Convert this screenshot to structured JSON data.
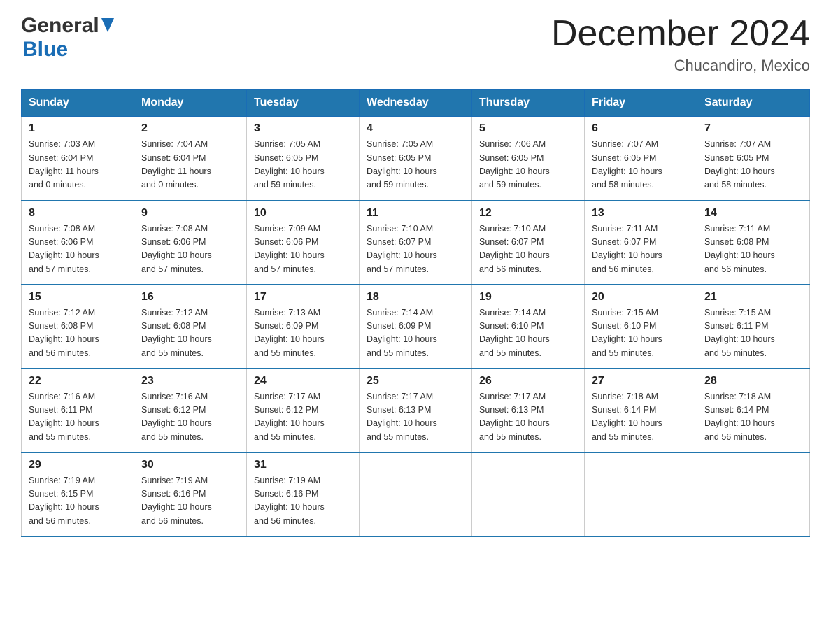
{
  "logo": {
    "general": "General",
    "blue": "Blue"
  },
  "header": {
    "month": "December 2024",
    "location": "Chucandiro, Mexico"
  },
  "weekdays": [
    "Sunday",
    "Monday",
    "Tuesday",
    "Wednesday",
    "Thursday",
    "Friday",
    "Saturday"
  ],
  "weeks": [
    [
      {
        "day": "1",
        "sunrise": "7:03 AM",
        "sunset": "6:04 PM",
        "daylight": "11 hours and 0 minutes."
      },
      {
        "day": "2",
        "sunrise": "7:04 AM",
        "sunset": "6:04 PM",
        "daylight": "11 hours and 0 minutes."
      },
      {
        "day": "3",
        "sunrise": "7:05 AM",
        "sunset": "6:05 PM",
        "daylight": "10 hours and 59 minutes."
      },
      {
        "day": "4",
        "sunrise": "7:05 AM",
        "sunset": "6:05 PM",
        "daylight": "10 hours and 59 minutes."
      },
      {
        "day": "5",
        "sunrise": "7:06 AM",
        "sunset": "6:05 PM",
        "daylight": "10 hours and 59 minutes."
      },
      {
        "day": "6",
        "sunrise": "7:07 AM",
        "sunset": "6:05 PM",
        "daylight": "10 hours and 58 minutes."
      },
      {
        "day": "7",
        "sunrise": "7:07 AM",
        "sunset": "6:05 PM",
        "daylight": "10 hours and 58 minutes."
      }
    ],
    [
      {
        "day": "8",
        "sunrise": "7:08 AM",
        "sunset": "6:06 PM",
        "daylight": "10 hours and 57 minutes."
      },
      {
        "day": "9",
        "sunrise": "7:08 AM",
        "sunset": "6:06 PM",
        "daylight": "10 hours and 57 minutes."
      },
      {
        "day": "10",
        "sunrise": "7:09 AM",
        "sunset": "6:06 PM",
        "daylight": "10 hours and 57 minutes."
      },
      {
        "day": "11",
        "sunrise": "7:10 AM",
        "sunset": "6:07 PM",
        "daylight": "10 hours and 57 minutes."
      },
      {
        "day": "12",
        "sunrise": "7:10 AM",
        "sunset": "6:07 PM",
        "daylight": "10 hours and 56 minutes."
      },
      {
        "day": "13",
        "sunrise": "7:11 AM",
        "sunset": "6:07 PM",
        "daylight": "10 hours and 56 minutes."
      },
      {
        "day": "14",
        "sunrise": "7:11 AM",
        "sunset": "6:08 PM",
        "daylight": "10 hours and 56 minutes."
      }
    ],
    [
      {
        "day": "15",
        "sunrise": "7:12 AM",
        "sunset": "6:08 PM",
        "daylight": "10 hours and 56 minutes."
      },
      {
        "day": "16",
        "sunrise": "7:12 AM",
        "sunset": "6:08 PM",
        "daylight": "10 hours and 55 minutes."
      },
      {
        "day": "17",
        "sunrise": "7:13 AM",
        "sunset": "6:09 PM",
        "daylight": "10 hours and 55 minutes."
      },
      {
        "day": "18",
        "sunrise": "7:14 AM",
        "sunset": "6:09 PM",
        "daylight": "10 hours and 55 minutes."
      },
      {
        "day": "19",
        "sunrise": "7:14 AM",
        "sunset": "6:10 PM",
        "daylight": "10 hours and 55 minutes."
      },
      {
        "day": "20",
        "sunrise": "7:15 AM",
        "sunset": "6:10 PM",
        "daylight": "10 hours and 55 minutes."
      },
      {
        "day": "21",
        "sunrise": "7:15 AM",
        "sunset": "6:11 PM",
        "daylight": "10 hours and 55 minutes."
      }
    ],
    [
      {
        "day": "22",
        "sunrise": "7:16 AM",
        "sunset": "6:11 PM",
        "daylight": "10 hours and 55 minutes."
      },
      {
        "day": "23",
        "sunrise": "7:16 AM",
        "sunset": "6:12 PM",
        "daylight": "10 hours and 55 minutes."
      },
      {
        "day": "24",
        "sunrise": "7:17 AM",
        "sunset": "6:12 PM",
        "daylight": "10 hours and 55 minutes."
      },
      {
        "day": "25",
        "sunrise": "7:17 AM",
        "sunset": "6:13 PM",
        "daylight": "10 hours and 55 minutes."
      },
      {
        "day": "26",
        "sunrise": "7:17 AM",
        "sunset": "6:13 PM",
        "daylight": "10 hours and 55 minutes."
      },
      {
        "day": "27",
        "sunrise": "7:18 AM",
        "sunset": "6:14 PM",
        "daylight": "10 hours and 55 minutes."
      },
      {
        "day": "28",
        "sunrise": "7:18 AM",
        "sunset": "6:14 PM",
        "daylight": "10 hours and 56 minutes."
      }
    ],
    [
      {
        "day": "29",
        "sunrise": "7:19 AM",
        "sunset": "6:15 PM",
        "daylight": "10 hours and 56 minutes."
      },
      {
        "day": "30",
        "sunrise": "7:19 AM",
        "sunset": "6:16 PM",
        "daylight": "10 hours and 56 minutes."
      },
      {
        "day": "31",
        "sunrise": "7:19 AM",
        "sunset": "6:16 PM",
        "daylight": "10 hours and 56 minutes."
      },
      null,
      null,
      null,
      null
    ]
  ],
  "labels": {
    "sunrise": "Sunrise:",
    "sunset": "Sunset:",
    "daylight": "Daylight:"
  }
}
